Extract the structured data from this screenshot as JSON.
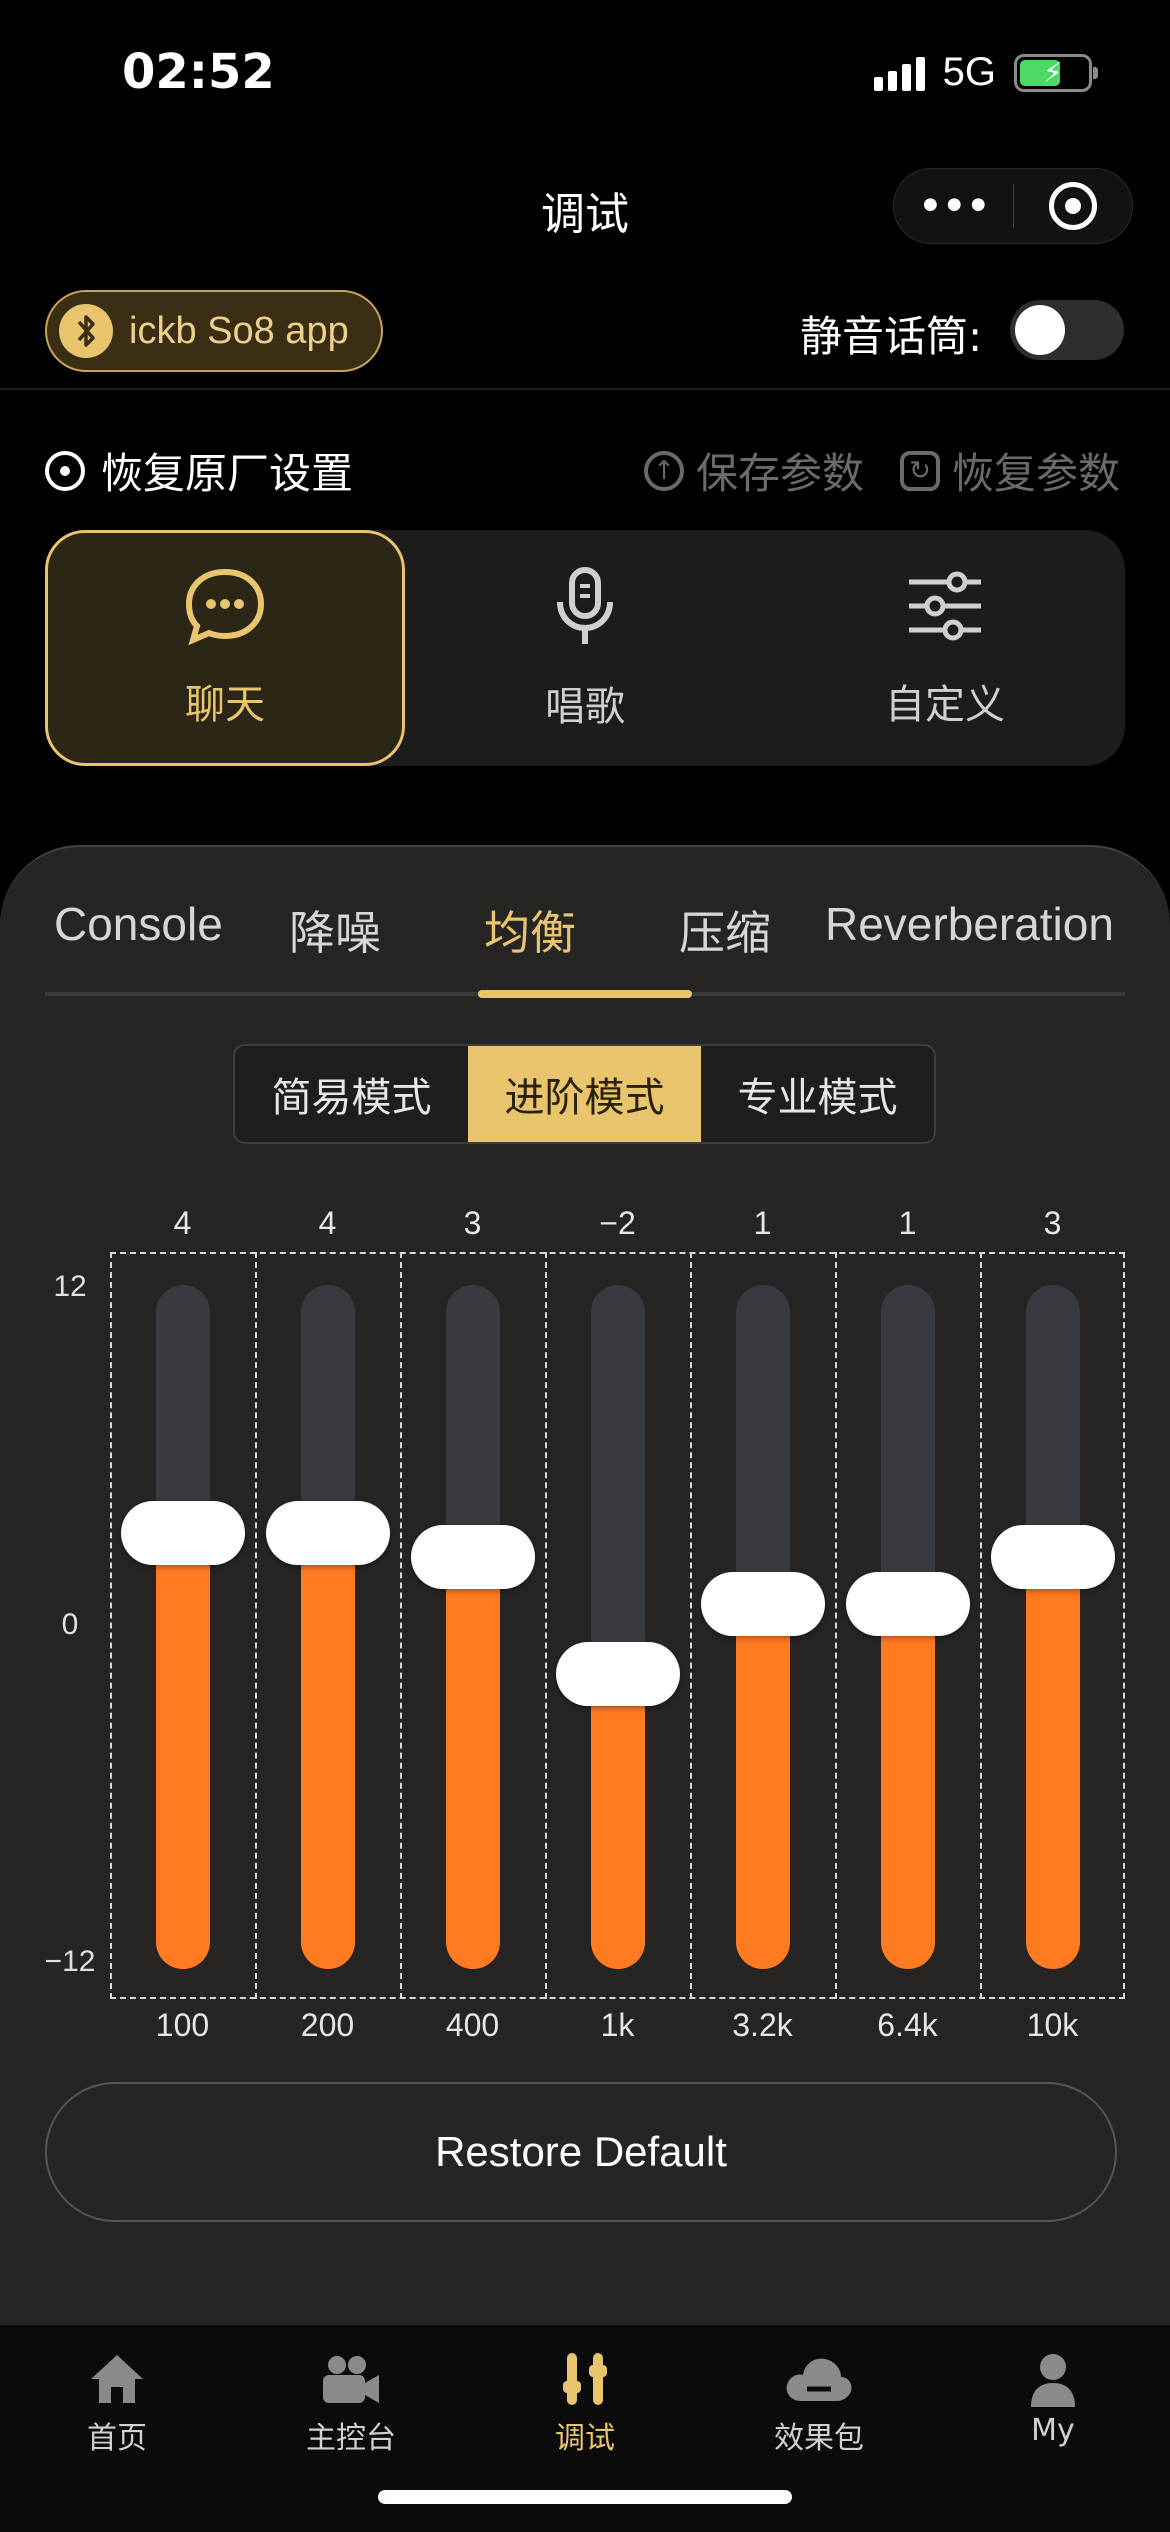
{
  "status": {
    "time": "02:52",
    "network": "5G"
  },
  "nav": {
    "title": "调试"
  },
  "device": {
    "name": "ickb So8 app",
    "mute_label": "静音话筒:"
  },
  "actions": {
    "restore_factory": "恢复原厂设置",
    "save_params": "保存参数",
    "load_params": "恢复参数"
  },
  "modes": [
    {
      "label": "聊天",
      "icon": "chat-bubble-icon",
      "active": true
    },
    {
      "label": "唱歌",
      "icon": "microphone-icon",
      "active": false
    },
    {
      "label": "自定义",
      "icon": "sliders-icon",
      "active": false
    }
  ],
  "tabs": [
    {
      "label": "Console",
      "active": false
    },
    {
      "label": "降噪",
      "active": false
    },
    {
      "label": "均衡",
      "active": true
    },
    {
      "label": "压缩",
      "active": false
    },
    {
      "label": "Reverberation",
      "active": false
    }
  ],
  "segments": [
    {
      "label": "简易模式",
      "active": false
    },
    {
      "label": "进阶模式",
      "active": true
    },
    {
      "label": "专业模式",
      "active": false
    }
  ],
  "eq": {
    "y_max_label": "12",
    "y_mid_label": "0",
    "y_min_label": "−12",
    "bands": [
      {
        "freq": "100",
        "value_label": "4",
        "value": 4
      },
      {
        "freq": "200",
        "value_label": "4",
        "value": 4
      },
      {
        "freq": "400",
        "value_label": "3",
        "value": 3
      },
      {
        "freq": "1k",
        "value_label": "−2",
        "value": -2
      },
      {
        "freq": "3.2k",
        "value_label": "1",
        "value": 1
      },
      {
        "freq": "6.4k",
        "value_label": "1",
        "value": 1
      },
      {
        "freq": "10k",
        "value_label": "3",
        "value": 3
      }
    ]
  },
  "restore_default": "Restore Default",
  "bottom_nav": [
    {
      "label": "首页",
      "icon": "home-icon",
      "active": false
    },
    {
      "label": "主控台",
      "icon": "video-camera-icon",
      "active": false
    },
    {
      "label": "调试",
      "icon": "tuning-icon",
      "active": true
    },
    {
      "label": "效果包",
      "icon": "cloud-icon",
      "active": false
    },
    {
      "label": "My",
      "icon": "user-icon",
      "active": false
    }
  ],
  "colors": {
    "accent": "#e8c46c",
    "eq_fill": "#ff7a21",
    "track": "#383a40"
  }
}
